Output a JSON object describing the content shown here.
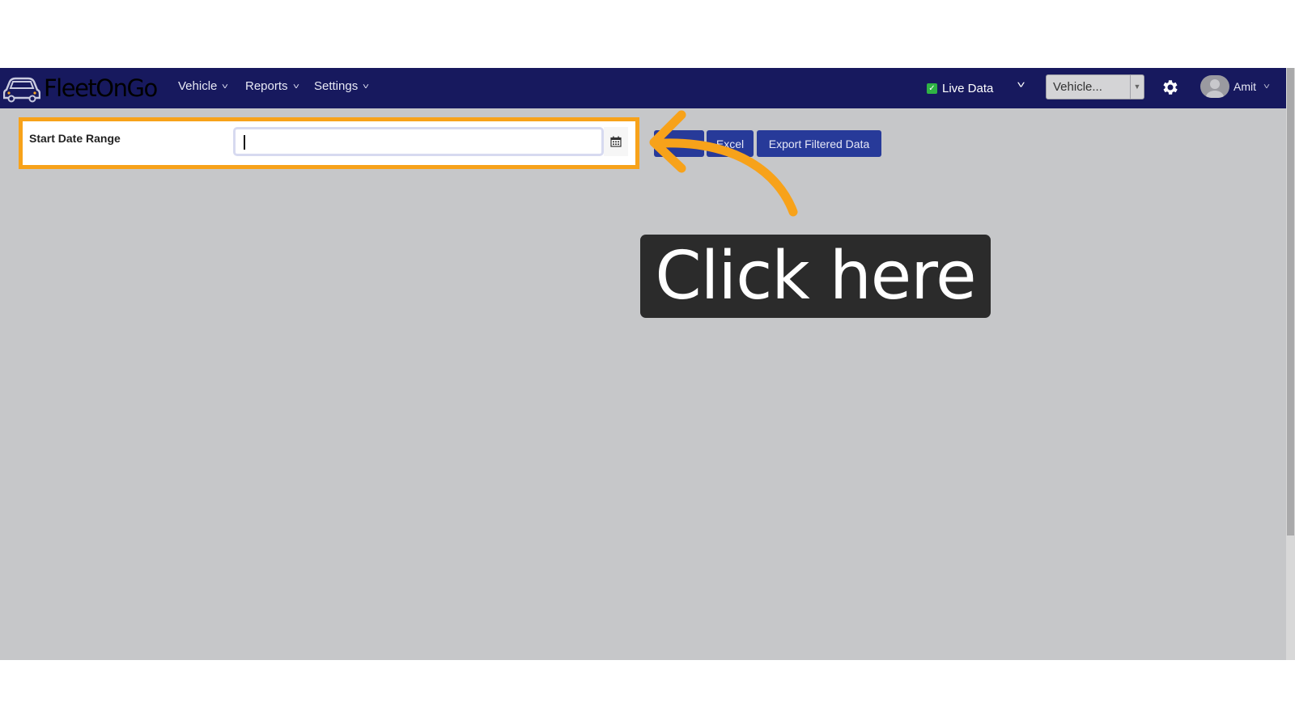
{
  "brand": {
    "name": "FleetOnGo",
    "icon": "car-logo-icon"
  },
  "nav": {
    "menus": [
      {
        "label": "Vehicle"
      },
      {
        "label": "Reports"
      },
      {
        "label": "Settings"
      }
    ],
    "live_data": {
      "label": "Live Data",
      "checked": true
    },
    "vehicle_select": {
      "value": "Vehicle..."
    },
    "user": {
      "name": "Amit"
    }
  },
  "filter": {
    "start_date_label": "Start Date Range",
    "start_date_value": "",
    "calendar_icon": "calendar-icon"
  },
  "actions": {
    "excel_label": "Excel",
    "export_label": "Export Filtered Data"
  },
  "callout": {
    "text": "Click here"
  },
  "colors": {
    "nav_bg": "#17195e",
    "brand_accent": "#f6a623",
    "highlight": "#f7a21a",
    "button_bg": "#273a99",
    "content_bg": "#c6c7c9",
    "callout_bg": "#2b2b2b",
    "live_check": "#2fb344"
  }
}
